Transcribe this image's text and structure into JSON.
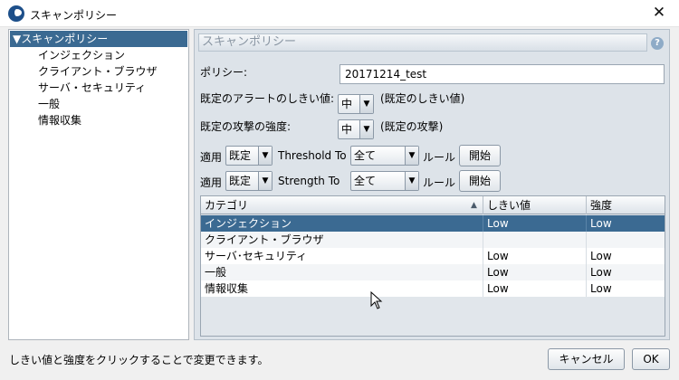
{
  "window": {
    "title": "スキャンポリシー",
    "close_symbol": "✕"
  },
  "tree": {
    "root": "▼スキャンポリシー",
    "children": [
      "インジェクション",
      "クライアント・ブラウザ",
      "サーバ・セキュリティ",
      "一般",
      "情報収集"
    ]
  },
  "panel": {
    "header": "スキャンポリシー",
    "help": "?",
    "policy_label": "ポリシー:",
    "policy_value": "20171214_test",
    "alert_threshold_label": "既定のアラートのしきい値:",
    "alert_threshold_value": "中",
    "alert_threshold_note": "(既定のしきい値)",
    "attack_strength_label": "既定の攻撃の強度:",
    "attack_strength_value": "中",
    "attack_strength_note": "(既定の攻撃)",
    "threshold_row": {
      "apply": "適用",
      "combo1": "既定",
      "to_label": "Threshold To",
      "combo2": "全て",
      "rule": "ルール",
      "go": "開始"
    },
    "strength_row": {
      "apply": "適用",
      "combo1": "既定",
      "to_label": "Strength To",
      "combo2": "全て",
      "rule": "ルール",
      "go": "開始"
    }
  },
  "table": {
    "headers": [
      "カテゴリ",
      "しきい値",
      "強度"
    ],
    "sort_symbol": "▲",
    "rows": [
      {
        "category": "インジェクション",
        "threshold": "Low",
        "strength": "Low"
      },
      {
        "category": "クライアント・ブラウザ",
        "threshold": "",
        "strength": ""
      },
      {
        "category": "サーバ･セキュリティ",
        "threshold": "Low",
        "strength": "Low"
      },
      {
        "category": "一般",
        "threshold": "Low",
        "strength": "Low"
      },
      {
        "category": "情報収集",
        "threshold": "Low",
        "strength": "Low"
      }
    ]
  },
  "footer": {
    "status": "しきい値と強度をクリックすることで変更できます。",
    "cancel": "キャンセル",
    "ok": "OK"
  },
  "icons": {
    "dropdown": "▼"
  },
  "colors": {
    "selection": "#3b6a92",
    "panel_bg": "#dde3e9"
  }
}
